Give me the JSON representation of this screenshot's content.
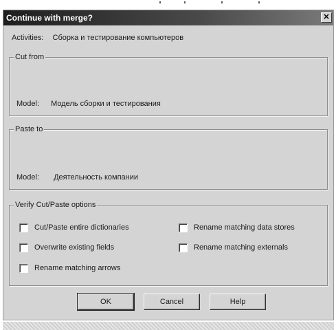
{
  "dialog": {
    "title": "Continue with merge?",
    "close_glyph": "✕",
    "activities_label": "Activities:",
    "activities_value": "Сборка и тестирование компьютеров"
  },
  "cut_from": {
    "legend": "Cut from",
    "model_label": "Model:",
    "model_value": "Модель сборки и тестирования"
  },
  "paste_to": {
    "legend": "Paste to",
    "model_label": "Model:",
    "model_value": "Деятельность компании"
  },
  "options": {
    "legend": "Verify Cut/Paste options",
    "items": [
      {
        "label": "Cut/Paste entire dictionaries",
        "checked": false
      },
      {
        "label": "Rename matching data stores",
        "checked": false
      },
      {
        "label": "Overwrite existing fields",
        "checked": false
      },
      {
        "label": "Rename matching externals",
        "checked": false
      },
      {
        "label": "Rename matching arrows",
        "checked": false
      }
    ]
  },
  "buttons": {
    "ok": "OK",
    "cancel": "Cancel",
    "help": "Help"
  }
}
